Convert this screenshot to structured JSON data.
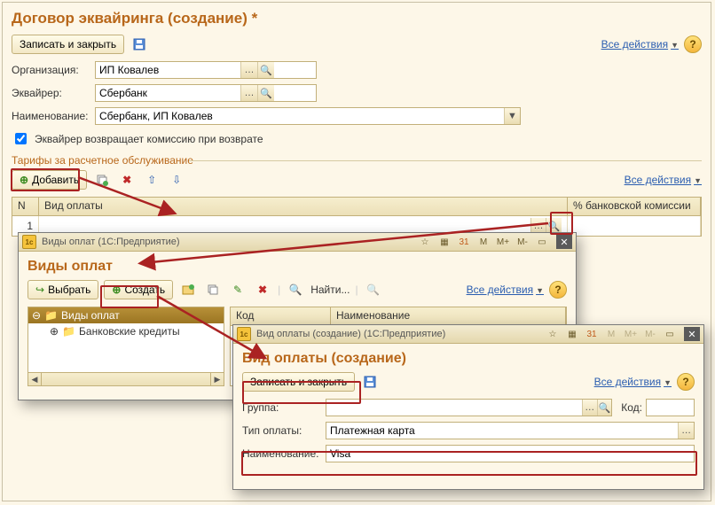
{
  "main": {
    "title": "Договор эквайринга (создание) *",
    "toolbar": {
      "save_close": "Записать и закрыть",
      "all_actions": "Все действия"
    },
    "fields": {
      "org_label": "Организация:",
      "org_value": "ИП Ковалев",
      "acq_label": "Эквайрер:",
      "acq_value": "Сбербанк",
      "name_label": "Наименование:",
      "name_value": "Сбербанк, ИП Ковалев",
      "checkbox_label": "Эквайрер возвращает комиссию при возврате"
    },
    "section": {
      "title": "Тарифы за расчетное обслуживание",
      "add": "Добавить",
      "all_actions": "Все действия"
    },
    "table": {
      "col_n": "N",
      "col_kind": "Вид оплаты",
      "col_comm": "% банковской комиссии",
      "row_n": "1"
    }
  },
  "types_win": {
    "titlebar": "Виды оплат  (1С:Предприятие)",
    "title": "Виды оплат",
    "toolbar": {
      "choose": "Выбрать",
      "create": "Создать",
      "find": "Найти...",
      "all_actions": "Все действия"
    },
    "tree": {
      "root": "Виды оплат",
      "child1": "Банковские кредиты"
    },
    "list": {
      "col_code": "Код",
      "col_name": "Наименование"
    }
  },
  "detail_win": {
    "titlebar": "Вид оплаты (создание)  (1С:Предприятие)",
    "title": "Вид оплаты (создание)",
    "toolbar": {
      "save_close": "Записать и закрыть",
      "all_actions": "Все действия"
    },
    "fields": {
      "group_label": "Группа:",
      "group_value": "",
      "code_label": "Код:",
      "code_value": "",
      "type_label": "Тип оплаты:",
      "type_value": "Платежная карта",
      "name_label": "Наименование:",
      "name_value": "Visa"
    }
  },
  "icons": {
    "mem": [
      "M",
      "M+",
      "M-"
    ]
  }
}
